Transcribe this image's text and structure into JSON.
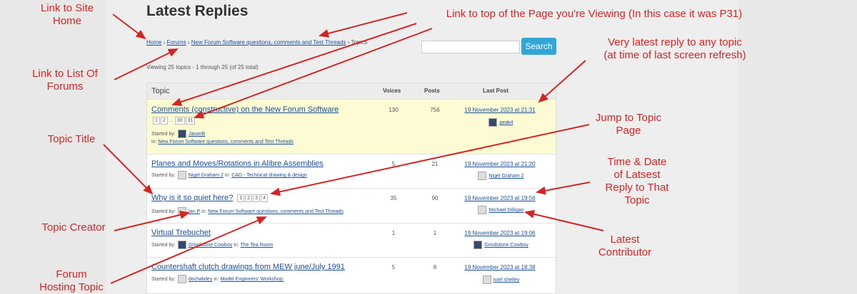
{
  "page": {
    "title": "Latest Replies",
    "breadcrumb": {
      "home": "Home",
      "sep1": "›",
      "forums": "Forums",
      "sep2": "›",
      "forum": "New Forum Software questions, comments and Test Threads",
      "sep3": "›",
      "current": "Topics"
    },
    "search": {
      "button_label": "Search",
      "value": ""
    },
    "viewing": "Viewing 25 topics - 1 through 25 (of 25 total)"
  },
  "table": {
    "headers": {
      "topic": "Topic",
      "voices": "Voices",
      "posts": "Posts",
      "last_post": "Last Post"
    },
    "rows": [
      {
        "title": "Comments (constructive) on the New Forum Software",
        "pages": [
          "1",
          "2",
          "…",
          "30",
          "31"
        ],
        "started_by_label": "Started by:",
        "author": "JasonB",
        "in_label": "in:",
        "forum": "New Forum Software questions, comments and Test Threads",
        "voices": "130",
        "posts": "756",
        "last_date": "19 November 2023 at 21:31",
        "last_user": "peak4"
      },
      {
        "title": "Planes and Moves/Rotations in Alibre Assemblies",
        "started_by_label": "Started by:",
        "author": "Nigel Graham 2",
        "in_label": "in:",
        "forum": "CAD - Technical drawing & design",
        "voices": "5",
        "posts": "21",
        "last_date": "19 November 2023 at 21:20",
        "last_user": "Nigel Graham 2"
      },
      {
        "title": "Why is it so quiet here?",
        "pages": [
          "1",
          "2",
          "3",
          "4"
        ],
        "started_by_label": "Started by:",
        "author": "Ian P",
        "in_label": "in:",
        "forum": "New Forum Software questions, comments and Test Threads",
        "voices": "35",
        "posts": "90",
        "last_date": "19 November 2023 at 19:56",
        "last_user": "Michael Dilligan"
      },
      {
        "title": "Virtual Trebuchet",
        "started_by_label": "Started by:",
        "author": "Grindstone Cowboy",
        "in_label": "in:",
        "forum": "The Tea Room",
        "voices": "1",
        "posts": "1",
        "last_date": "19 November 2023 at 19:06",
        "last_user": "Grindstone Cowboy"
      },
      {
        "title": "Countershaft clutch drawings from MEW june/July 1991",
        "started_by_label": "Started by:",
        "author": "dochalidey",
        "in_label": "in:",
        "forum": "Model Engineers' Workshop.",
        "voices": "5",
        "posts": "8",
        "last_date": "19 November 2023 at 18:38",
        "last_user": "noel shelley"
      }
    ]
  },
  "callouts": {
    "site_home": "Link to Site\nHome",
    "top_of_page": "Link to top of the Page you're Viewing (In this case it was P31)",
    "list_of_forums": "Link to List Of\nForums",
    "very_latest": "Very latest reply to any topic\n(at time of last screen refresh)",
    "jump_to_page": "Jump to Topic\nPage",
    "topic_title": "Topic Title",
    "time_date": "Time & Date\nof Latsest\nReply to That\nTopic",
    "topic_creator": "Topic Creator",
    "latest_contributor": "Latest\nContributor",
    "forum_hosting": "Forum\nHosting Topic"
  },
  "colors": {
    "callout": "#d42525",
    "link": "#1a4f9c",
    "search_button": "#33a6d8",
    "sticky_row": "#fdfbd3"
  }
}
